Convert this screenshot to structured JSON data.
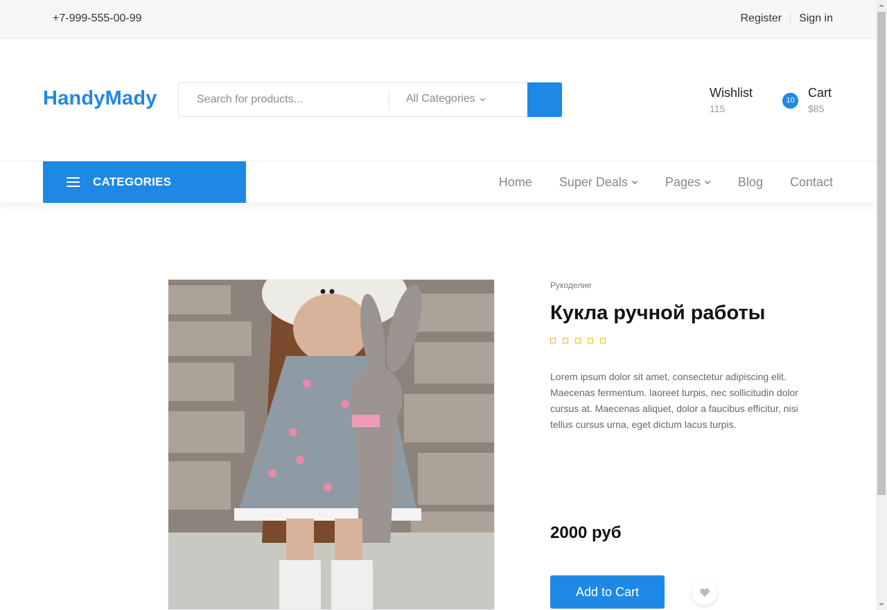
{
  "topbar": {
    "phone": "+7-999-555-00-99",
    "register_label": "Register",
    "signin_label": "Sign in"
  },
  "header": {
    "logo": "HandyMady",
    "search": {
      "placeholder": "Search for products...",
      "category_label": "All Categories",
      "button_icon": "search-icon"
    },
    "wishlist": {
      "label": "Wishlist",
      "value": "115"
    },
    "cart": {
      "badge": "10",
      "label": "Cart",
      "value": "$85"
    }
  },
  "nav": {
    "categories_label": "CATEGORIES",
    "items": [
      {
        "label": "Home",
        "dropdown": false
      },
      {
        "label": "Super Deals",
        "dropdown": true
      },
      {
        "label": "Pages",
        "dropdown": true
      },
      {
        "label": "Blog",
        "dropdown": false
      },
      {
        "label": "Contact",
        "dropdown": false
      }
    ]
  },
  "product": {
    "category": "Рукоделие",
    "title": "Кукла ручной работы",
    "rating": 0,
    "rating_max": 5,
    "description": "Lorem ipsum dolor sit amet, consectetur adipiscing elit. Maecenas fermentum. laoreet turpis, nec sollicitudin dolor cursus at. Maecenas aliquet, dolor a faucibus efficitur, nisi tellus cursus urna, eget dictum lacus turpis.",
    "price": "2000 руб",
    "add_to_cart_label": "Add to Cart",
    "wishlist_icon": "heart-icon"
  },
  "colors": {
    "accent": "#1e88e5",
    "star": "#f5b81a"
  }
}
